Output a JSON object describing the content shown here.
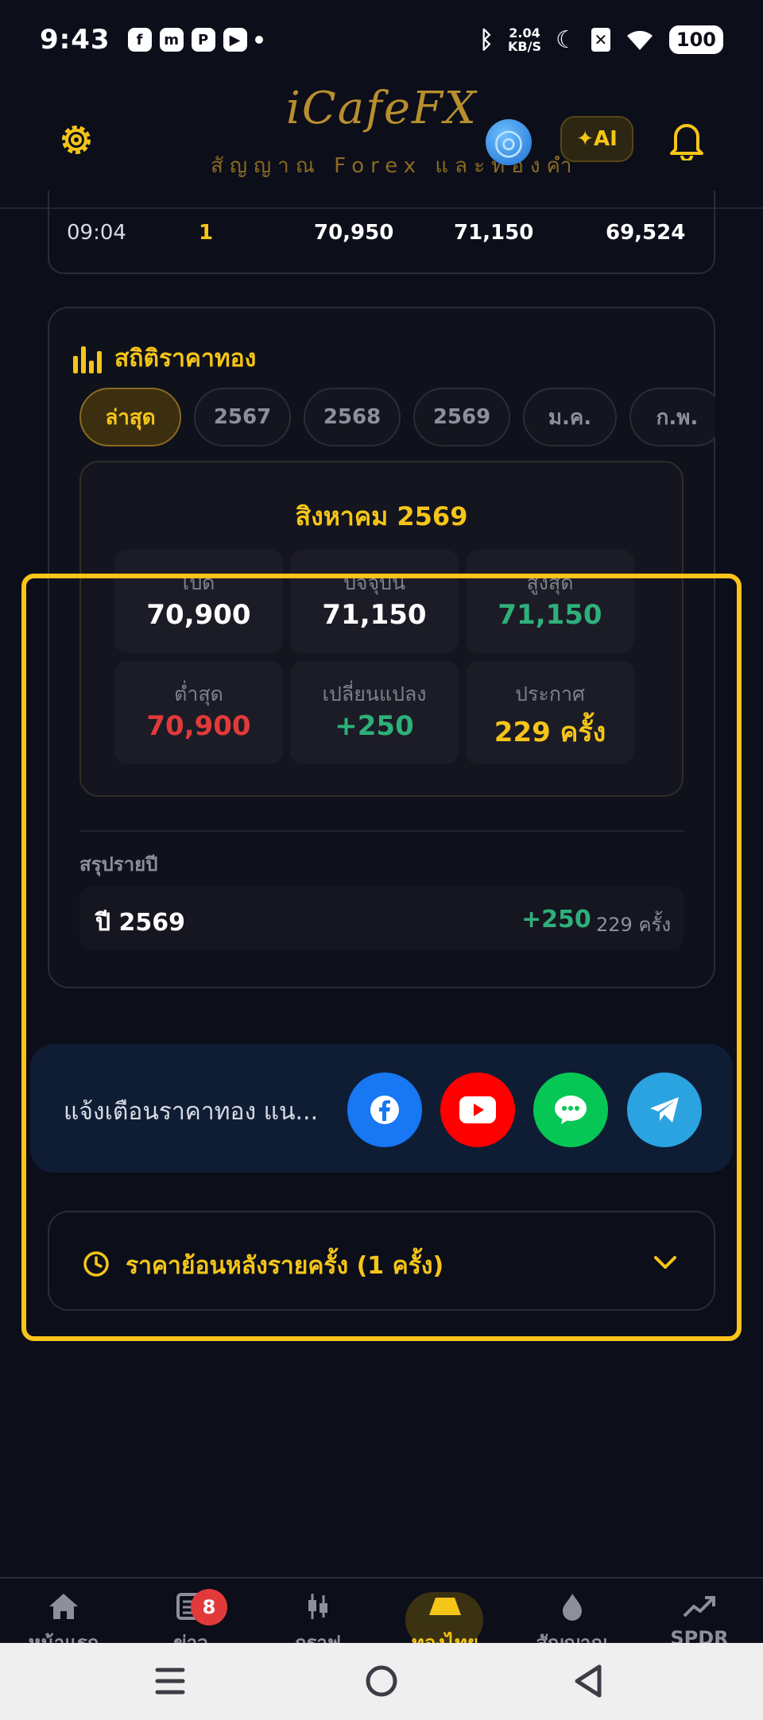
{
  "status_bar": {
    "time": "9:43",
    "app_icons": [
      "facebook-icon",
      "messenger-icon",
      "app-icon",
      "youtube-icon"
    ],
    "speed_line1": "2.04",
    "speed_line2": "KB/S",
    "battery": "100"
  },
  "header": {
    "logo": "iCafeFX",
    "subtitle": "สัญญาณ Forex และทองคำ",
    "ai_label": "✦AI"
  },
  "prev_table_row": {
    "time": "09:04",
    "count": "1",
    "v1": "70,950",
    "v2": "71,150",
    "v3": "69,524"
  },
  "stats": {
    "title": "สถิติราคาทอง",
    "chips": [
      "ล่าสุด",
      "2567",
      "2568",
      "2569",
      "ม.ค.",
      "ก.พ."
    ],
    "active_chip": "ล่าสุด",
    "month_title": "สิงหาคม 2569",
    "cells": [
      {
        "label": "เปิด",
        "value": "70,900"
      },
      {
        "label": "ปัจจุบัน",
        "value": "71,150"
      },
      {
        "label": "สูงสุด",
        "value": "71,150"
      },
      {
        "label": "ต่ำสุด",
        "value": "70,900"
      },
      {
        "label": "เปลี่ยนแปลง",
        "value": "+250"
      },
      {
        "label": "ประกาศ",
        "value": "229 ครั้ง"
      }
    ],
    "year_summary_label": "สรุปรายปี",
    "year_row": {
      "year": "ปี 2569",
      "change": "+250",
      "count": "229 ครั้ง"
    }
  },
  "alert": {
    "text": "แจ้งเตือนราคาทอง แน...",
    "social": [
      {
        "name": "facebook",
        "color": "#1877f2"
      },
      {
        "name": "youtube",
        "color": "#ff0000"
      },
      {
        "name": "line",
        "color": "#06c755"
      },
      {
        "name": "telegram",
        "color": "#2aa3e0"
      }
    ]
  },
  "history": {
    "title": "ราคาย้อนหลังรายครั้ง (1 ครั้ง)"
  },
  "tabs": [
    {
      "label": "หน้าแรก",
      "icon": "home-icon"
    },
    {
      "label": "ข่าว",
      "icon": "news-icon",
      "badge": "8"
    },
    {
      "label": "กราฟ",
      "icon": "chart-icon"
    },
    {
      "label": "ทองไทย",
      "icon": "gold-bar-icon",
      "active": true
    },
    {
      "label": "สัญญาณ",
      "icon": "flame-icon"
    },
    {
      "label": "SPDR",
      "icon": "trend-icon"
    }
  ],
  "colors": {
    "accent": "#f5c518",
    "up": "#2fb07a",
    "down": "#e23a3a",
    "background": "#0c0e1a"
  }
}
